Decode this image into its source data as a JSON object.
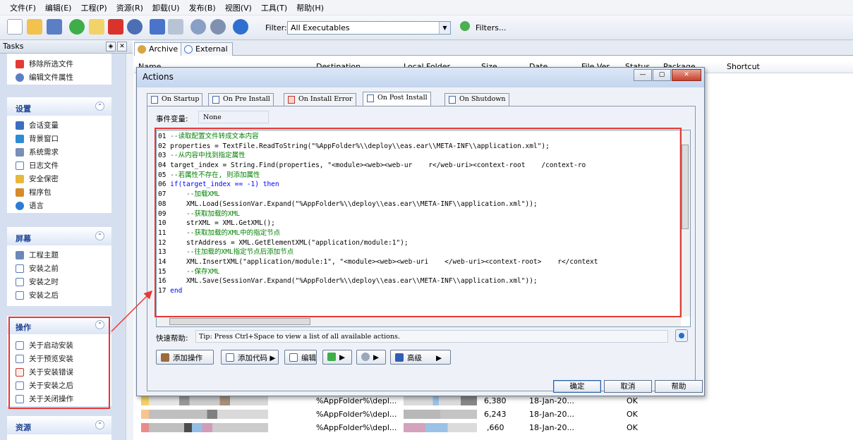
{
  "menu": [
    "文件(F)",
    "编辑(E)",
    "工程(P)",
    "资源(R)",
    "卸载(U)",
    "发布(B)",
    "视图(V)",
    "工具(T)",
    "帮助(H)"
  ],
  "toolbar": {
    "filter_label": "Filter:",
    "filter_value": "All Executables",
    "filters_button": "Filters..."
  },
  "tasks": {
    "title": "Tasks",
    "top_items": [
      "移除所选文件",
      "编辑文件属性"
    ],
    "groups": [
      {
        "title": "设置",
        "items": [
          "会话变量",
          "背景窗口",
          "系统需求",
          "日志文件",
          "安全保密",
          "程序包",
          "语言"
        ]
      },
      {
        "title": "屏幕",
        "items": [
          "工程主题",
          "安装之前",
          "安装之时",
          "安装之后"
        ]
      },
      {
        "title": "操作",
        "items": [
          "关于启动安装",
          "关于预览安装",
          "关于安装错误",
          "关于安装之后",
          "关于关闭操作"
        ]
      },
      {
        "title": "资源",
        "items": []
      }
    ]
  },
  "main_tabs": [
    "Archive",
    "External"
  ],
  "columns": [
    "Name",
    "Destination",
    "Local Folder",
    "Size",
    "Date",
    "File Ver.",
    "Status",
    "Package",
    "Shortcut"
  ],
  "rows": [
    {
      "destination": "%AppFolder%\\depl...",
      "size": "6,380",
      "date": "18-Jan-20...",
      "status": "OK"
    },
    {
      "destination": "%AppFolder%\\depl...",
      "size": "6,243",
      "date": "18-Jan-20...",
      "status": "OK"
    },
    {
      "destination": "%AppFolder%\\depl...",
      "size": ",660",
      "date": "18-Jan-20...",
      "status": "OK"
    }
  ],
  "dialog": {
    "title": "Actions",
    "tabs": [
      "On Startup",
      "On Pre Install",
      "On Install Error",
      "On Post Install",
      "On Shutdown"
    ],
    "event_label": "事件变量:",
    "event_value": "None",
    "code": [
      "01 --读取配置文件转成文本内容",
      "02 properties = TextFile.ReadToString(\"%AppFolder%\\\\deploy\\\\eas.ear\\\\META-INF\\\\application.xml\");",
      "03 --从内容中找到指定属性",
      "04 target_index = String.Find(properties, \"<module><web><web-ur    r</web-uri><context-root    /context-ro",
      "05 --若属性不存在, 则添加属性",
      "06 if(target_index == -1) then",
      "07     --加载XML",
      "08     XML.Load(SessionVar.Expand(\"%AppFolder%\\\\deploy\\\\eas.ear\\\\META-INF\\\\application.xml\"));",
      "09     --获取加载的XML",
      "10     strXML = XML.GetXML();",
      "11     --获取加载的XML中的指定节点",
      "12     strAddress = XML.GetElementXML(\"application/module:1\");",
      "13     --往加载的XML指定节点后添加节点",
      "14     XML.InsertXML(\"application/module:1\", \"<module><web><web-uri    </web-uri><context-root>    r</context",
      "15     --保存XML",
      "16     XML.Save(SessionVar.Expand(\"%AppFolder%\\\\deploy\\\\eas.ear\\\\META-INF\\\\application.xml\"));",
      "17 end"
    ],
    "help_label": "快速帮助:",
    "help_text": "Tip: Press Ctrl+Space to view a list of all available actions.",
    "action_buttons": [
      "添加操作",
      "添加代码",
      "编辑(E)",
      "高级"
    ],
    "ok": "确定",
    "cancel": "取消",
    "help": "帮助"
  },
  "colors": {
    "annotation": "#e53935",
    "group_title": "#1f4594",
    "keyword": "#0000ff",
    "comment": "#008000",
    "string": "#800080"
  }
}
